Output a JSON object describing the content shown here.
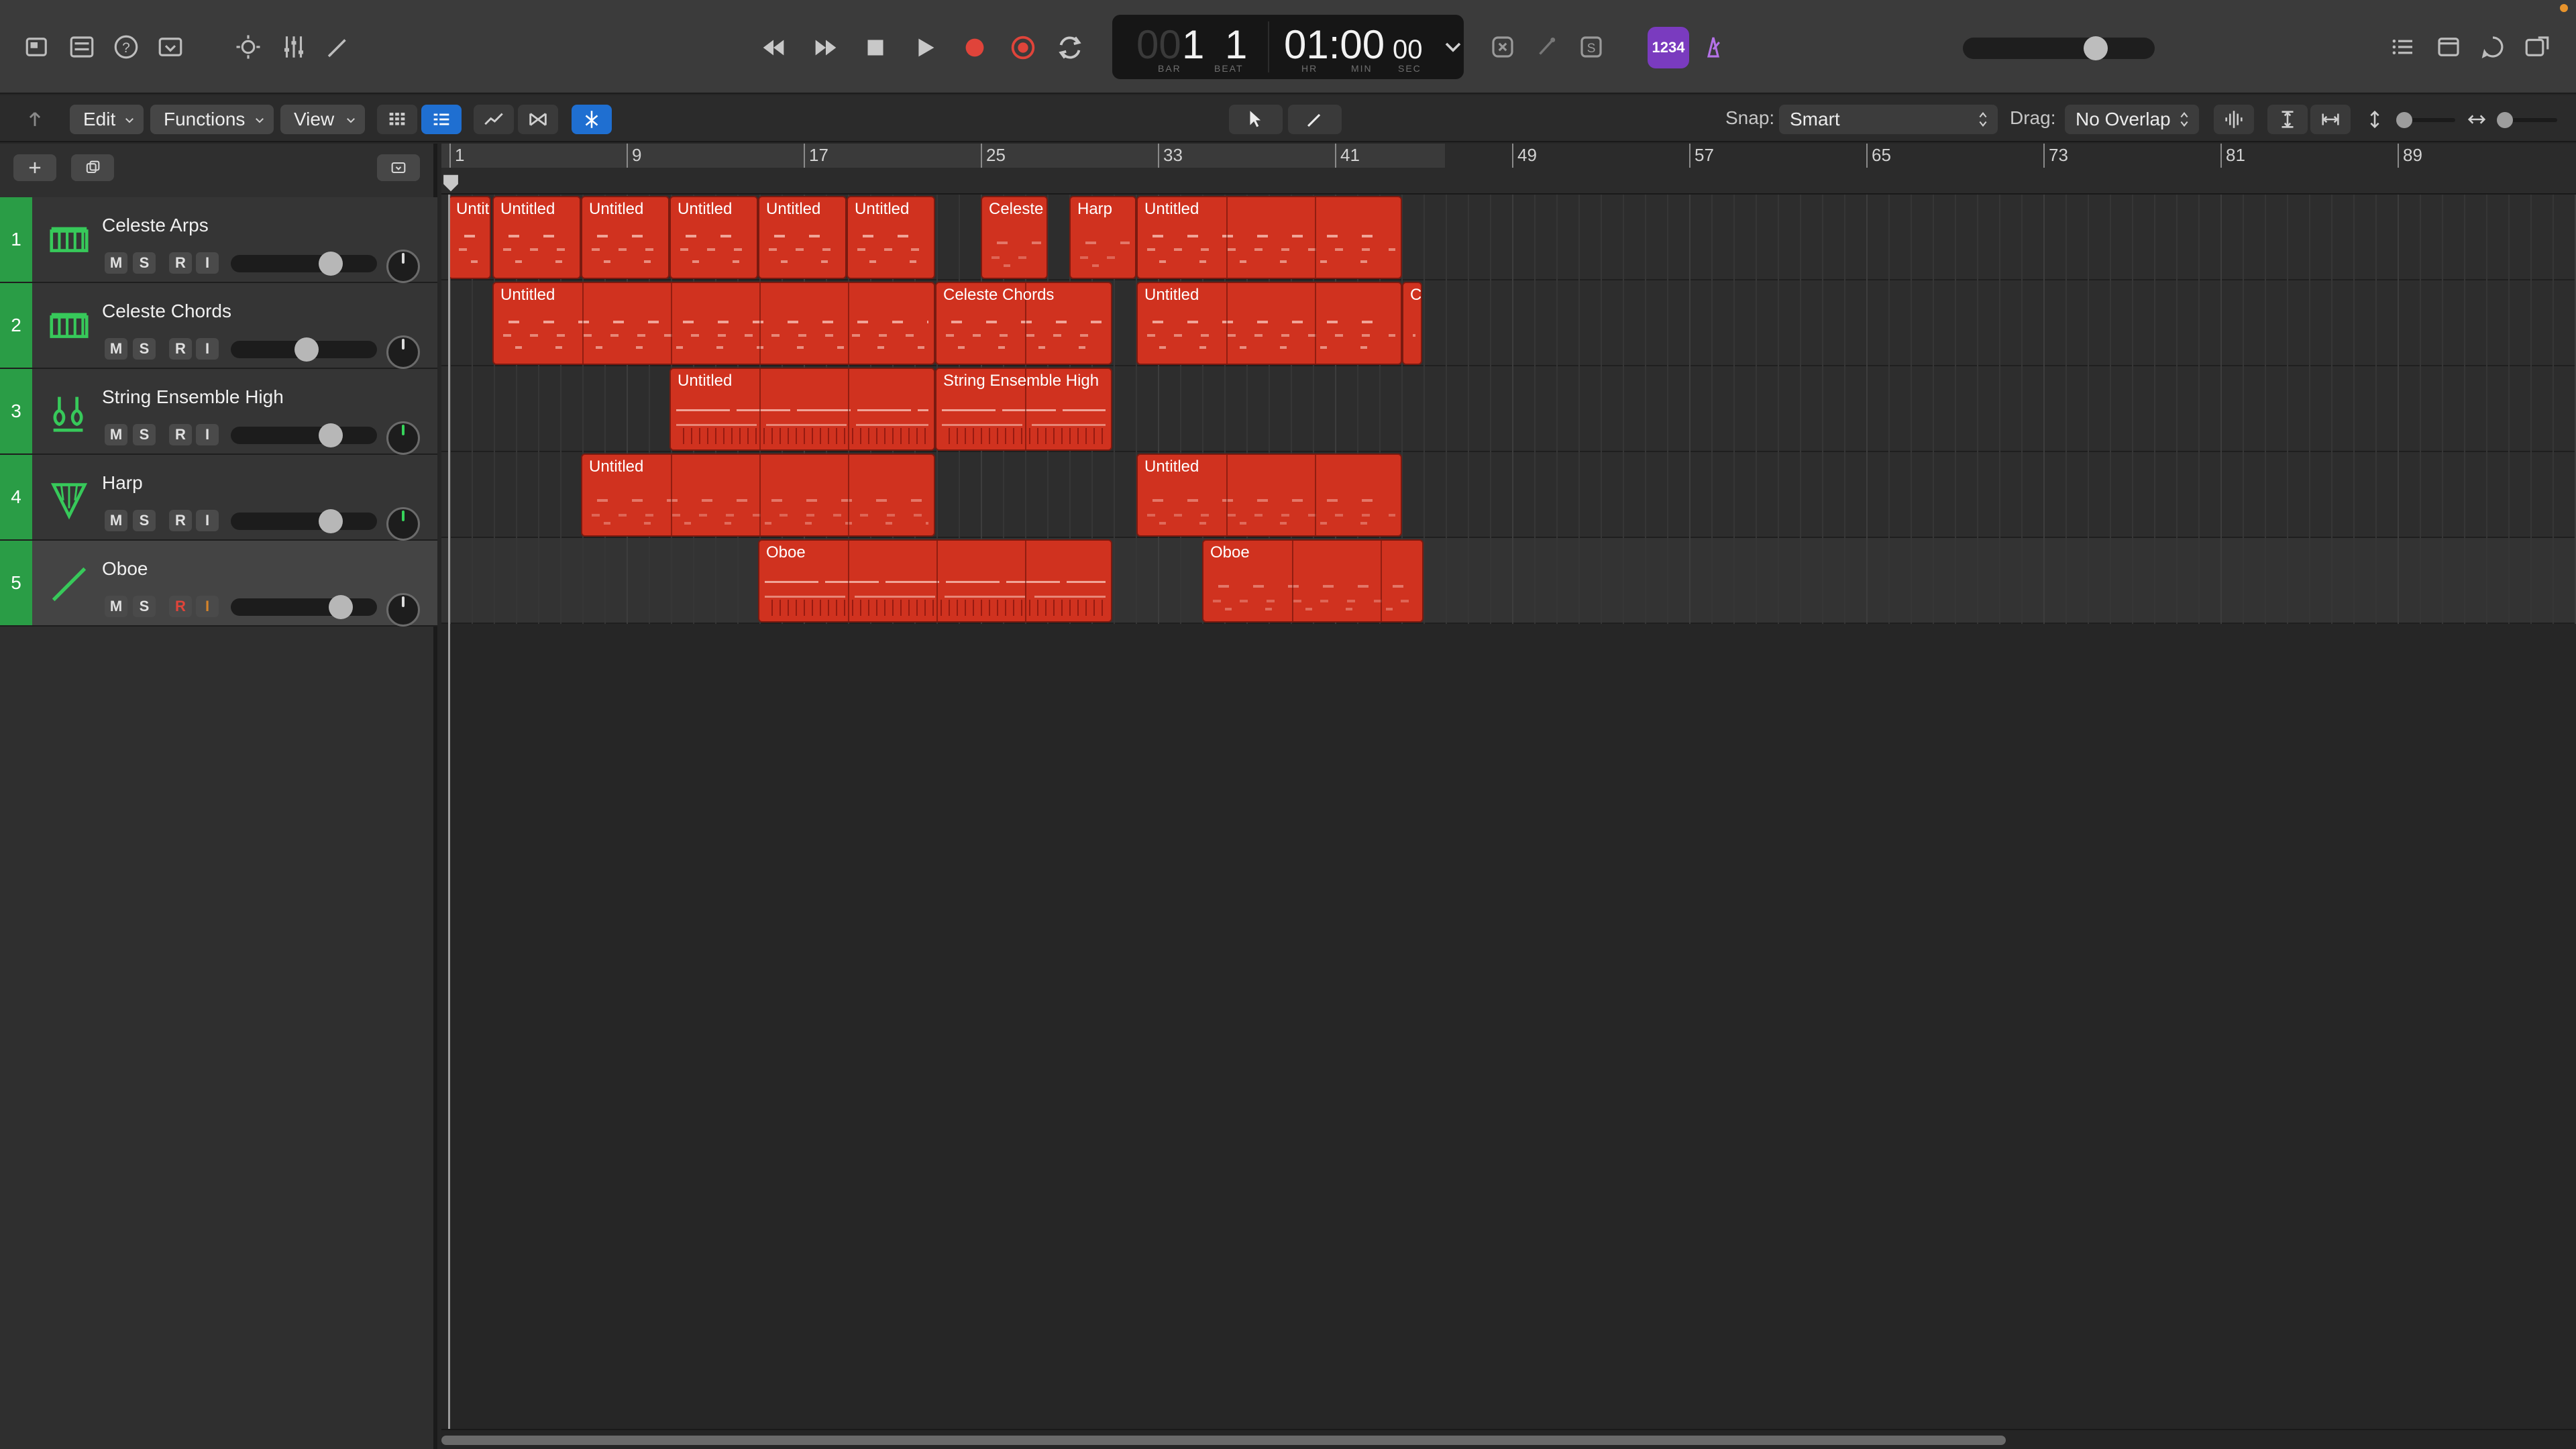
{
  "window": {
    "app": "Logic Pro"
  },
  "lcd": {
    "bar_dim": "00",
    "bar": "1",
    "beat": "1",
    "time_main": "01:00",
    "time_frac": "00",
    "cap_bar": "BAR",
    "cap_beat": "BEAT",
    "cap_hr": "HR",
    "cap_min": "MIN",
    "cap_sec": "SEC"
  },
  "controlbar": {
    "count_in_badge": "1234",
    "master_volume_percent": 72
  },
  "toolbar": {
    "edit_label": "Edit",
    "functions_label": "Functions",
    "view_label": "View",
    "snap_label": "Snap:",
    "snap_value": "Smart",
    "drag_label": "Drag:",
    "drag_value": "No Overlap"
  },
  "colors": {
    "track_color": "#2a9d46",
    "region_color": "#d0321f",
    "record_red": "#e0443a",
    "badge_purple": "#7a3bbf"
  },
  "ruler": {
    "bar_labels": [
      "1",
      "9",
      "17",
      "25",
      "33",
      "41",
      "49",
      "57",
      "65",
      "73",
      "81",
      "89"
    ]
  },
  "tracks": [
    {
      "number": "1",
      "name": "Celeste Arps",
      "icon": "keyboard-icon",
      "mute": "M",
      "solo": "S",
      "record": "R",
      "input": "I",
      "volume_percent": 72,
      "pan": "center"
    },
    {
      "number": "2",
      "name": "Celeste Chords",
      "icon": "keyboard-icon",
      "mute": "M",
      "solo": "S",
      "record": "R",
      "input": "I",
      "volume_percent": 52,
      "pan": "center"
    },
    {
      "number": "3",
      "name": "String Ensemble High",
      "icon": "violin-icon",
      "mute": "M",
      "solo": "S",
      "record": "R",
      "input": "I",
      "volume_percent": 72,
      "pan": "center"
    },
    {
      "number": "4",
      "name": "Harp",
      "icon": "harp-icon",
      "mute": "M",
      "solo": "S",
      "record": "R",
      "input": "I",
      "volume_percent": 72,
      "pan": "center"
    },
    {
      "number": "5",
      "name": "Oboe",
      "icon": "oboe-icon",
      "mute": "M",
      "solo": "S",
      "record": "R",
      "input": "I",
      "volume_percent": 80,
      "pan": "center",
      "record_armed": true,
      "selected": true
    }
  ],
  "regions": {
    "track1": [
      "Untit",
      "Untitled",
      "Untitled",
      "Untitled",
      "Untitled",
      "Untitled",
      "Celeste",
      "Harp",
      "Untitled"
    ],
    "track2": [
      "Untitled",
      "Celeste Chords",
      "Untitled",
      "C"
    ],
    "track3": [
      "Untitled",
      "String Ensemble High"
    ],
    "track4": [
      "Untitled",
      "Untitled"
    ],
    "track5": [
      "Oboe",
      "Oboe"
    ]
  }
}
